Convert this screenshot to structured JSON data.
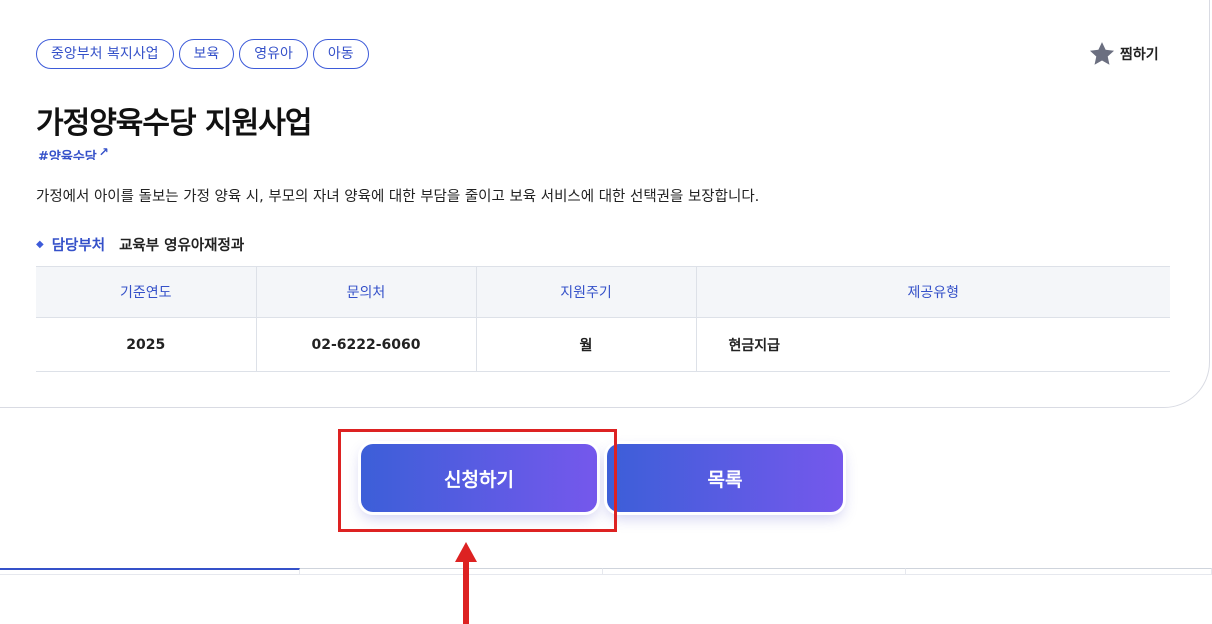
{
  "tags": [
    "중앙부처 복지사업",
    "보육",
    "영유아",
    "아동"
  ],
  "favorite": {
    "label": "찜하기",
    "icon": "star-icon",
    "icon_color": "#6b6f80"
  },
  "title": "가정양육수당 지원사업",
  "hashtag": {
    "text": "#양육수당",
    "icon": "external-link-icon"
  },
  "description": "가정에서 아이를 돌보는 가정 양육 시, 부모의 자녀 양육에 대한 부담을 줄이고 보육 서비스에 대한 선택권을 보장합니다.",
  "department": {
    "label": "담당부처",
    "value": "교육부 영유아재정과"
  },
  "table": {
    "headers": [
      "기준연도",
      "문의처",
      "지원주기",
      "제공유형"
    ],
    "row": [
      "2025",
      "02-6222-6060",
      "월",
      "현금지급"
    ]
  },
  "buttons": {
    "apply": "신청하기",
    "list": "목록"
  },
  "colors": {
    "accent": "#3551c9",
    "button_gradient_start": "#3c5fd8",
    "button_gradient_end": "#7558ec",
    "highlight": "#dd2222"
  }
}
